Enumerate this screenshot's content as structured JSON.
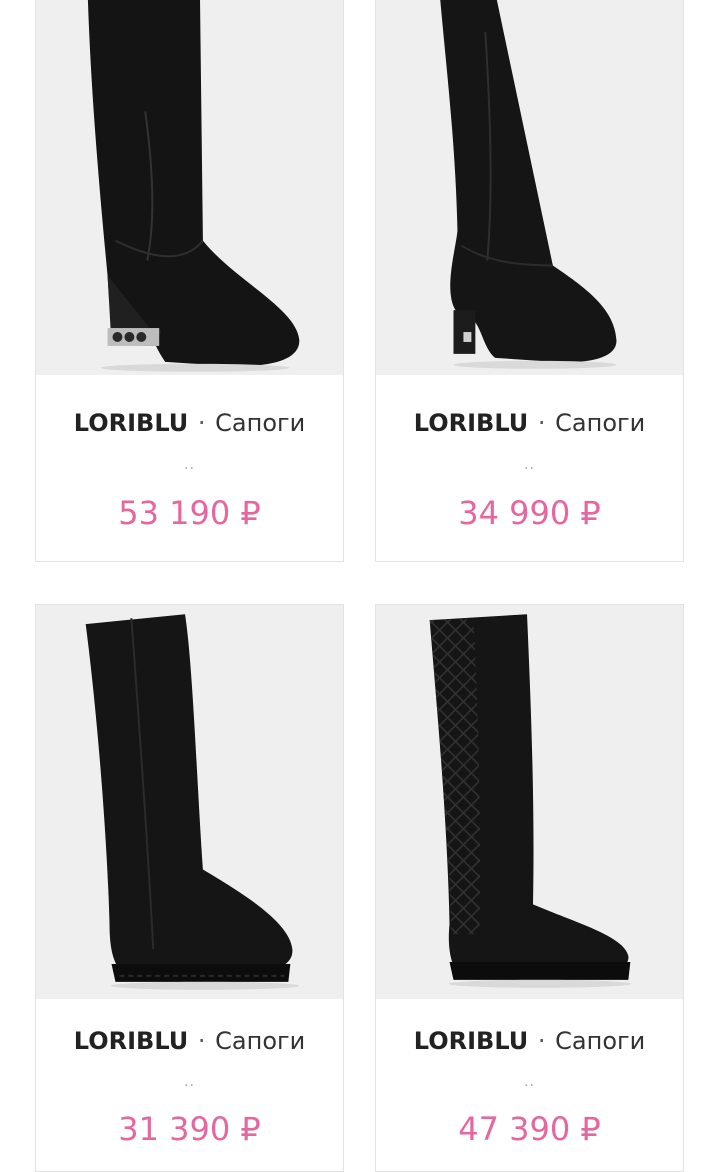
{
  "products": [
    {
      "brand": "LORIBLU",
      "separator": "·",
      "category": "Сапоги",
      "dots": "··",
      "price": "53 190 ₽",
      "image_icon": "boot-image"
    },
    {
      "brand": "LORIBLU",
      "separator": "·",
      "category": "Сапоги",
      "dots": "··",
      "price": "34 990 ₽",
      "image_icon": "boot-image"
    },
    {
      "brand": "LORIBLU",
      "separator": "·",
      "category": "Сапоги",
      "dots": "··",
      "price": "31 390 ₽",
      "image_icon": "boot-image"
    },
    {
      "brand": "LORIBLU",
      "separator": "·",
      "category": "Сапоги",
      "dots": "··",
      "price": "47 390 ₽",
      "image_icon": "boot-image"
    }
  ],
  "colors": {
    "price": "#e5679f",
    "image_background": "#efefef",
    "card_border": "#e3e3e3"
  }
}
